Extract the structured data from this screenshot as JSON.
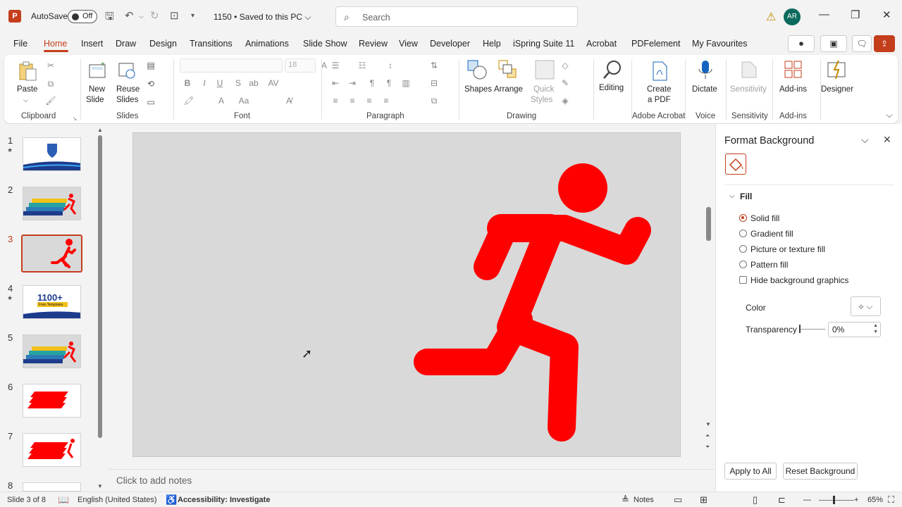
{
  "titlebar": {
    "app_icon": "P",
    "autosave_label": "AutoSave",
    "autosave_state": "Off",
    "doc_title": "1150 • Saved to this PC ⌵",
    "search_placeholder": "Search",
    "user_initials": "AR"
  },
  "menu": {
    "items": [
      "File",
      "Home",
      "Insert",
      "Draw",
      "Design",
      "Transitions",
      "Animations",
      "Slide Show",
      "Review",
      "View",
      "Developer",
      "Help",
      "iSpring Suite 11",
      "Acrobat",
      "PDFelement",
      "My Favourites"
    ],
    "active": "Home"
  },
  "ribbon": {
    "groups": [
      "Clipboard",
      "Slides",
      "Font",
      "Paragraph",
      "Drawing",
      "Adobe Acrobat",
      "Voice",
      "Sensitivity",
      "Add-ins"
    ],
    "paste": "Paste",
    "new_slide_1": "New",
    "new_slide_2": "Slide",
    "reuse_1": "Reuse",
    "reuse_2": "Slides",
    "font_size": "18",
    "shapes": "Shapes",
    "arrange": "Arrange",
    "quick_1": "Quick",
    "quick_2": "Styles",
    "editing": "Editing",
    "create_1": "Create",
    "create_2": "a PDF",
    "dictate": "Dictate",
    "sensitivity": "Sensitivity",
    "addins": "Add-ins",
    "designer": "Designer"
  },
  "thumbnails": {
    "numbers": [
      "1",
      "2",
      "3",
      "4",
      "5",
      "6",
      "7",
      "8"
    ],
    "active": "3",
    "promo_1": "1100+",
    "promo_2": "Free Templates"
  },
  "canvas": {
    "notes_placeholder": "Click to add notes",
    "figure_color": "#ff0000",
    "background_color": "#d9d9d9"
  },
  "format_pane": {
    "title": "Format Background",
    "section": "Fill",
    "options": [
      "Solid fill",
      "Gradient fill",
      "Picture or texture fill",
      "Pattern fill"
    ],
    "selected": "Solid fill",
    "hide_graphics": "Hide background graphics",
    "color_label": "Color",
    "transparency_label": "Transparency",
    "transparency_value": "0%",
    "apply_all": "Apply to All",
    "reset": "Reset Background"
  },
  "status": {
    "slide_info": "Slide 3 of 8",
    "language": "English (United States)",
    "accessibility": "Accessibility: Investigate",
    "notes": "Notes",
    "zoom": "65%"
  }
}
